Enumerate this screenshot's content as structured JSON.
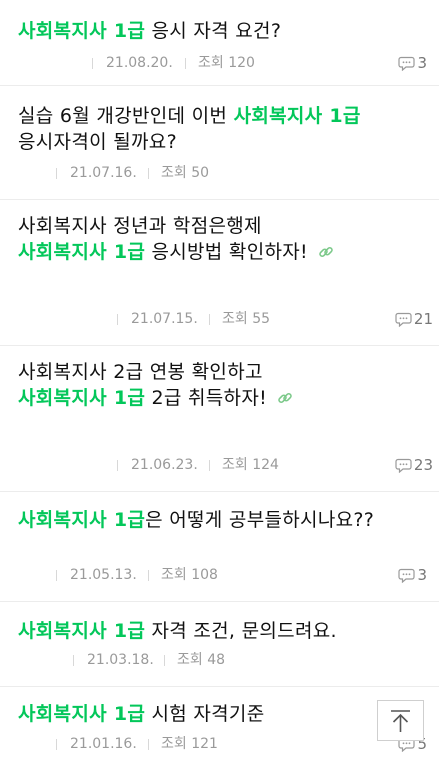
{
  "posts": [
    {
      "title": [
        {
          "t": "사회복지사 1급",
          "hl": true
        },
        {
          "t": " 응시 자격 요건?",
          "hl": false
        }
      ],
      "date": "21.08.20.",
      "views": "조회 120",
      "comments": "3",
      "has_link": false
    },
    {
      "title": [
        {
          "t": "실습 6월 개강반인데 이번 ",
          "hl": false
        },
        {
          "t": "사회복지사 1급",
          "hl": true
        },
        {
          "t": " 응시자격이 될까요?",
          "hl": false
        }
      ],
      "date": "21.07.16.",
      "views": "조회 50",
      "comments": "",
      "has_link": false
    },
    {
      "title": [
        {
          "t": "사회복지사 정년과 학점은행제 ",
          "hl": false
        },
        {
          "t": "사회복지사 1급",
          "hl": true
        },
        {
          "t": " 응시방법 확인하자!",
          "hl": false
        }
      ],
      "date": "21.07.15.",
      "views": "조회 55",
      "comments": "21",
      "has_link": true
    },
    {
      "title": [
        {
          "t": "사회복지사 2급 연봉 확인하고 ",
          "hl": false
        },
        {
          "t": "사회복지사 1급",
          "hl": true
        },
        {
          "t": " 2급 취득하자!",
          "hl": false
        }
      ],
      "date": "21.06.23.",
      "views": "조회 124",
      "comments": "23",
      "has_link": true
    },
    {
      "title": [
        {
          "t": "사회복지사 1급",
          "hl": true
        },
        {
          "t": "은 어떻게 공부들하시나요??",
          "hl": false
        }
      ],
      "date": "21.05.13.",
      "views": "조회 108",
      "comments": "3",
      "has_link": false
    },
    {
      "title": [
        {
          "t": "사회복지사 1급",
          "hl": true
        },
        {
          "t": " 자격 조건, 문의드려요.",
          "hl": false
        }
      ],
      "date": "21.03.18.",
      "views": "조회 48",
      "comments": "",
      "has_link": false
    },
    {
      "title": [
        {
          "t": "사회복지사 1급",
          "hl": true
        },
        {
          "t": " 시험 자격기준",
          "hl": false
        }
      ],
      "date": "21.01.16.",
      "views": "조회 121",
      "comments": "5",
      "has_link": false
    }
  ],
  "colors": {
    "highlight": "#03c75a",
    "meta": "#9a9a9a"
  },
  "icons": {
    "comment": "comment-icon",
    "link": "link-icon",
    "scroll_top": "arrow-up-to-top-icon"
  }
}
